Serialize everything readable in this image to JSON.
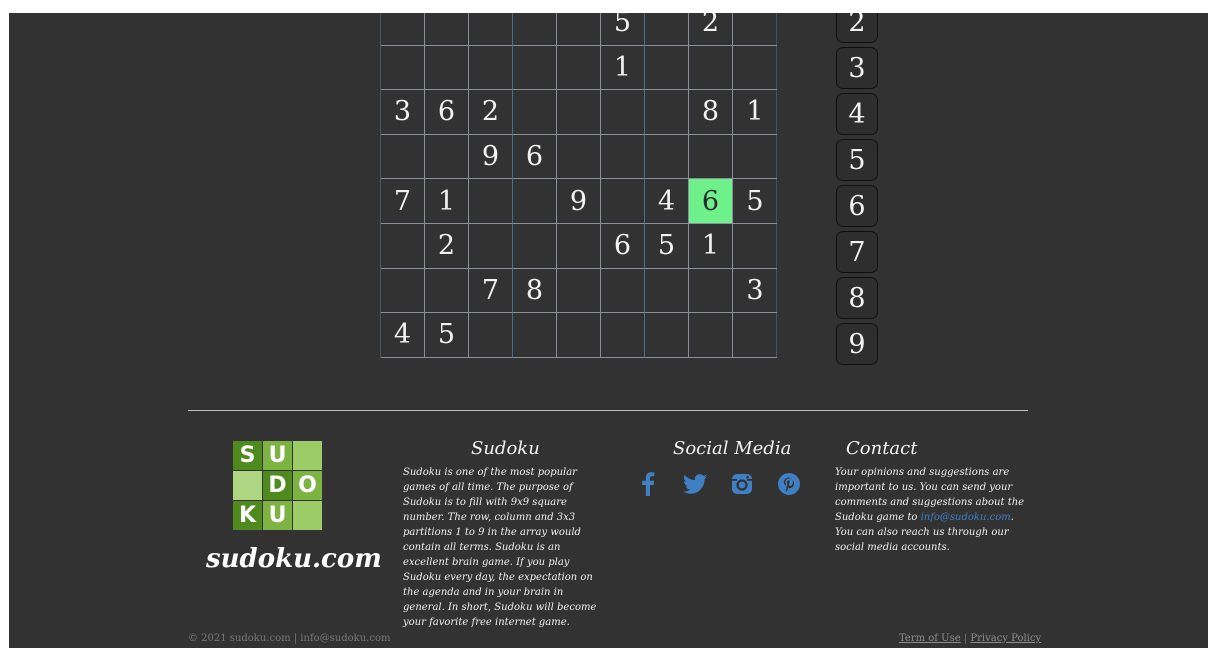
{
  "board": {
    "rows": [
      [
        "",
        "",
        "",
        "",
        "",
        "5",
        "",
        "2",
        ""
      ],
      [
        "",
        "",
        "",
        "",
        "",
        "1",
        "",
        "",
        ""
      ],
      [
        "3",
        "6",
        "2",
        "",
        "",
        "",
        "",
        "8",
        "1"
      ],
      [
        "",
        "",
        "9",
        "6",
        "",
        "",
        "",
        "",
        ""
      ],
      [
        "7",
        "1",
        "",
        "",
        "9",
        "",
        "4",
        "6",
        "5"
      ],
      [
        "",
        "2",
        "",
        "",
        "",
        "6",
        "5",
        "1",
        ""
      ],
      [
        "",
        "",
        "7",
        "8",
        "",
        "",
        "",
        "",
        "3"
      ],
      [
        "4",
        "5",
        "",
        "",
        "",
        "",
        "",
        "",
        ""
      ]
    ],
    "highlighted": {
      "row": 4,
      "col": 7
    },
    "highlight_color": "#6ef08a"
  },
  "numpad": [
    "2",
    "3",
    "4",
    "5",
    "6",
    "7",
    "8",
    "9"
  ],
  "logo": {
    "tiles": [
      "S",
      "U",
      "",
      "",
      "D",
      "O",
      "K",
      "U",
      ""
    ],
    "colors": [
      "#4f8a1f",
      "#7cb342",
      "#9ccc65",
      "#aed581",
      "#4f8a1f",
      "#7cb342",
      "#4f8a1f",
      "#7cb342",
      "#9ccc65"
    ],
    "text": "sudoku.com"
  },
  "footer": {
    "about_title": "Sudoku",
    "about_text": "Sudoku is one of the most popular games of all time. The purpose of Sudoku is to fill with 9x9 square number. The row, column and 3x3 partitions 1 to 9 in the array would contain all terms. Sudoku is an excellent brain game. If you play Sudoku every day, the expectation on the agenda and in your brain in general. In short, Sudoku will become your favorite free internet game.",
    "social_title": "Social Media",
    "social_icons": [
      "facebook-icon",
      "twitter-icon",
      "instagram-icon",
      "pinterest-icon"
    ],
    "social_color": "#3f7fc4",
    "contact_title": "Contact",
    "contact_text_before": "Your opinions and suggestions are important to us. You can send your comments and suggestions about the Sudoku game to ",
    "contact_email": "info@sudoku.com",
    "contact_text_after": ". You can also reach us through our social media accounts.",
    "copyright": "© 2021 sudoku.com | info@sudoku.com",
    "terms": "Term of Use",
    "separator": "|",
    "privacy": "Privacy Policy"
  }
}
